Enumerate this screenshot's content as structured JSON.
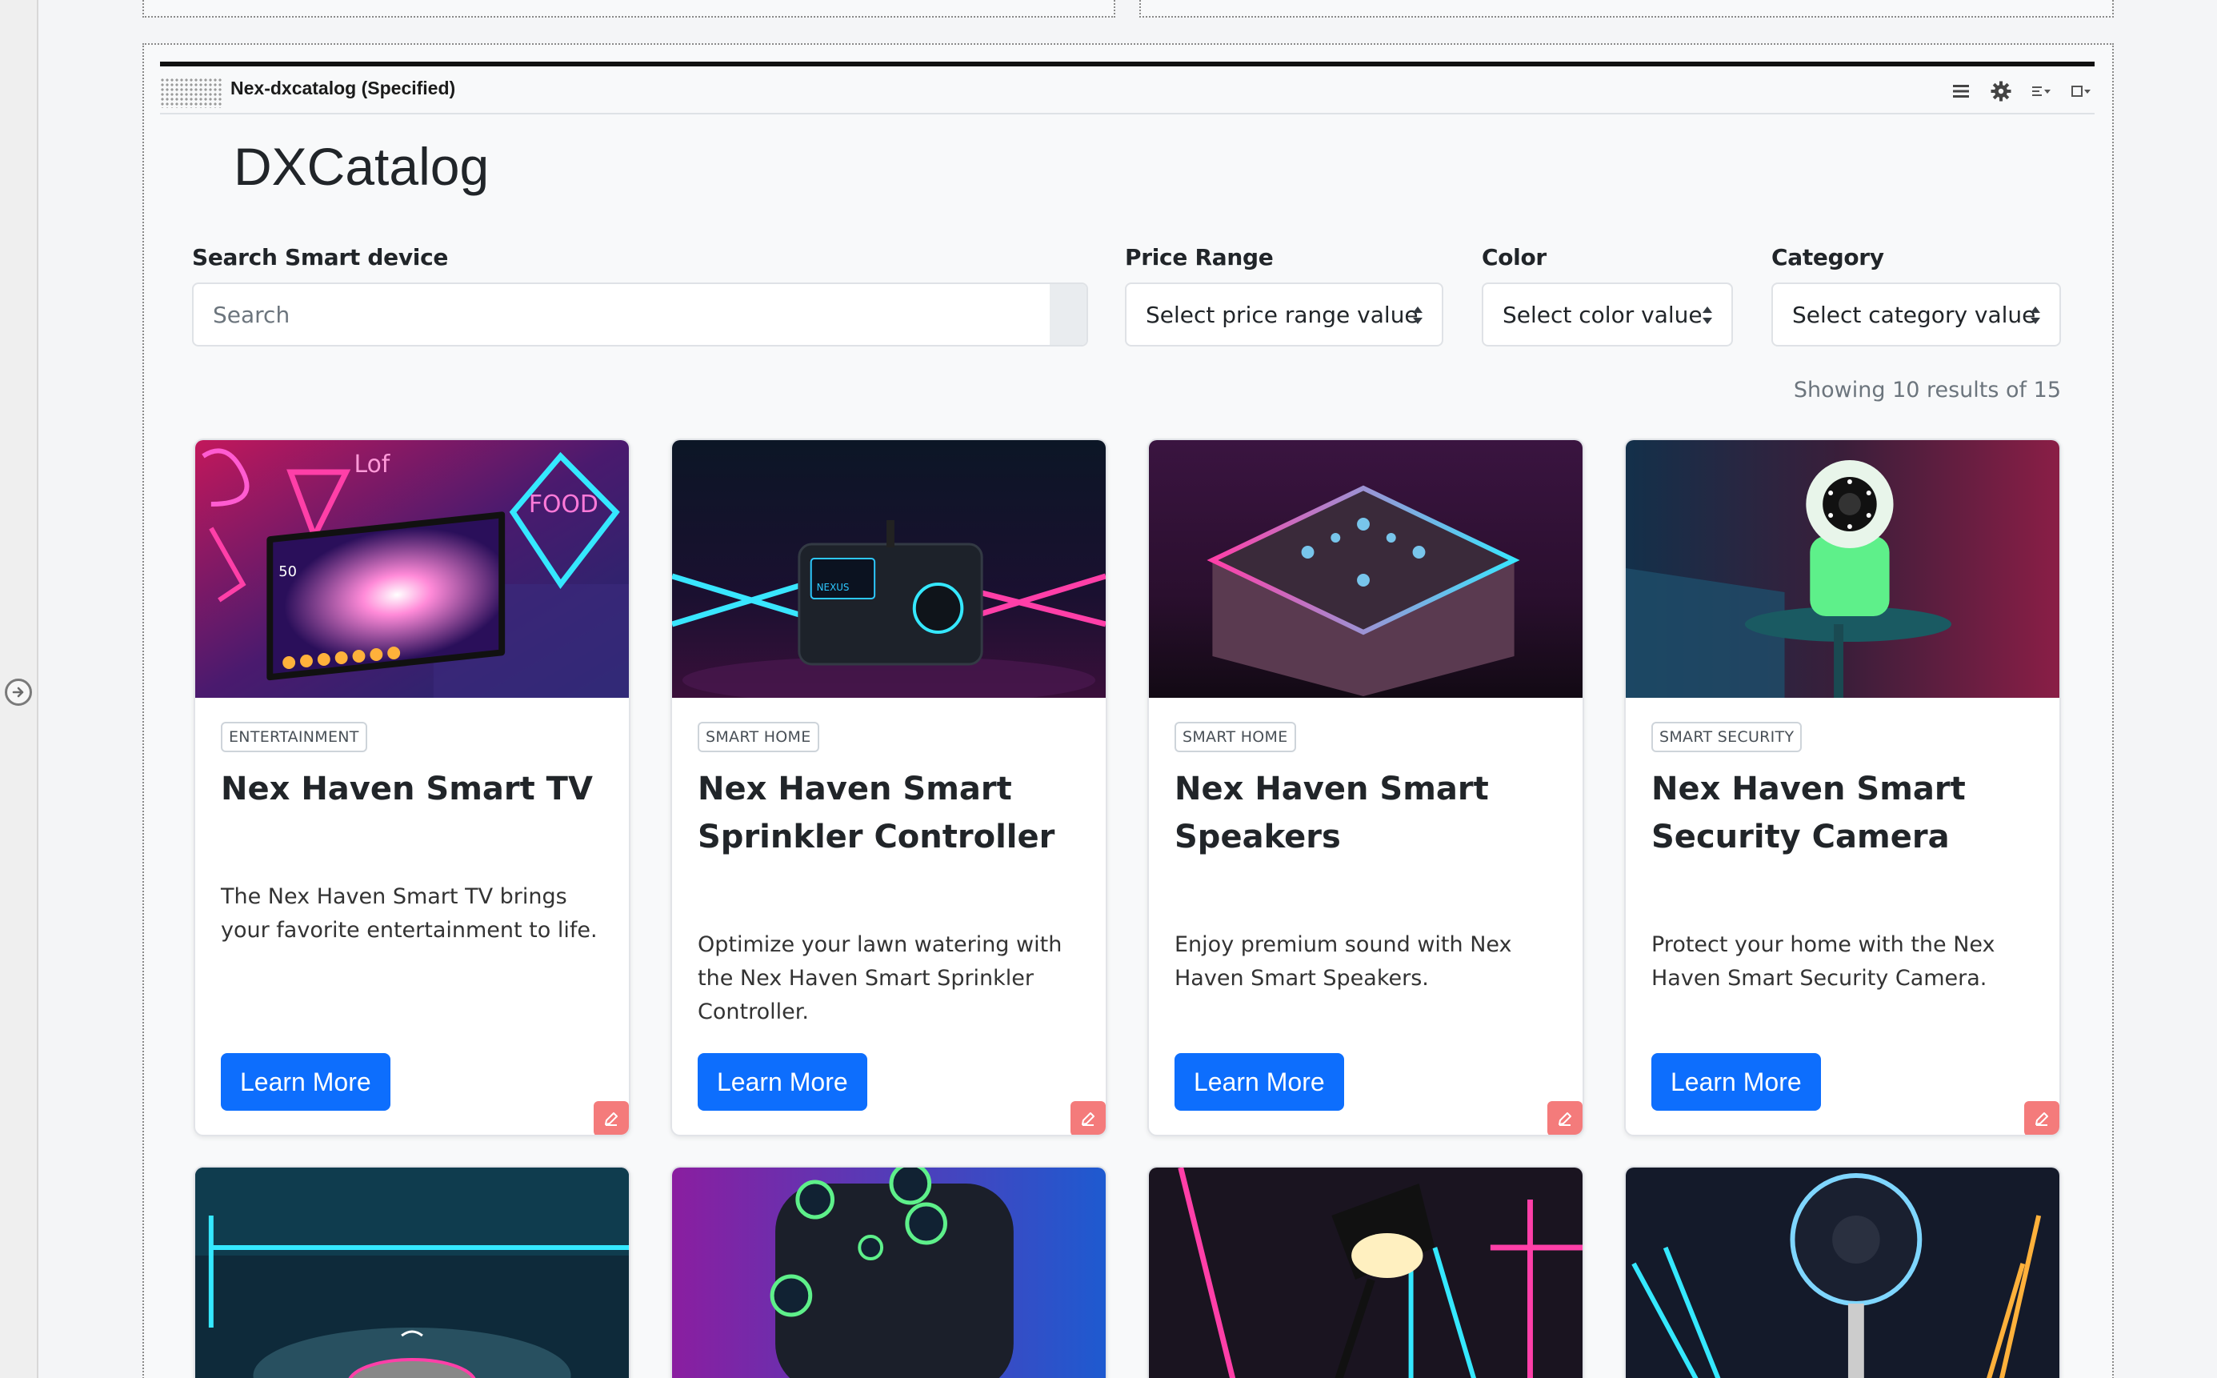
{
  "portlet": {
    "title": "Nex-dxcatalog (Specified)",
    "tools": [
      "menu-icon",
      "gear-icon",
      "layout-icon",
      "window-icon"
    ]
  },
  "app": {
    "title": "DXCatalog"
  },
  "filters": {
    "search": {
      "label": "Search Smart device",
      "placeholder": "Search",
      "value": ""
    },
    "price": {
      "label": "Price Range",
      "value": "Select price range value"
    },
    "color": {
      "label": "Color",
      "value": "Select color value"
    },
    "category": {
      "label": "Category",
      "value": "Select category value"
    }
  },
  "results": {
    "text": "Showing 10 results of 15"
  },
  "products": [
    {
      "category": "ENTERTAINMENT",
      "title": "Nex Haven Smart TV",
      "description": "The Nex Haven Smart TV brings your favorite entertainment to life.",
      "button": "Learn More"
    },
    {
      "category": "SMART HOME",
      "title": "Nex Haven Smart Sprinkler Controller",
      "description": "Optimize your lawn watering with the Nex Haven Smart Sprinkler Controller.",
      "button": "Learn More"
    },
    {
      "category": "SMART HOME",
      "title": "Nex Haven Smart Speakers",
      "description": "Enjoy premium sound with Nex Haven Smart Speakers.",
      "button": "Learn More"
    },
    {
      "category": "SMART SECURITY",
      "title": "Nex Haven Smart Security Camera",
      "description": "Protect your home with the Nex Haven Smart Security Camera.",
      "button": "Learn More"
    }
  ],
  "colors": {
    "primary": "#0d6efd",
    "edit": "#f47b7b",
    "neon_pink": "#ff2fa0",
    "neon_cyan": "#2fe6ff"
  }
}
